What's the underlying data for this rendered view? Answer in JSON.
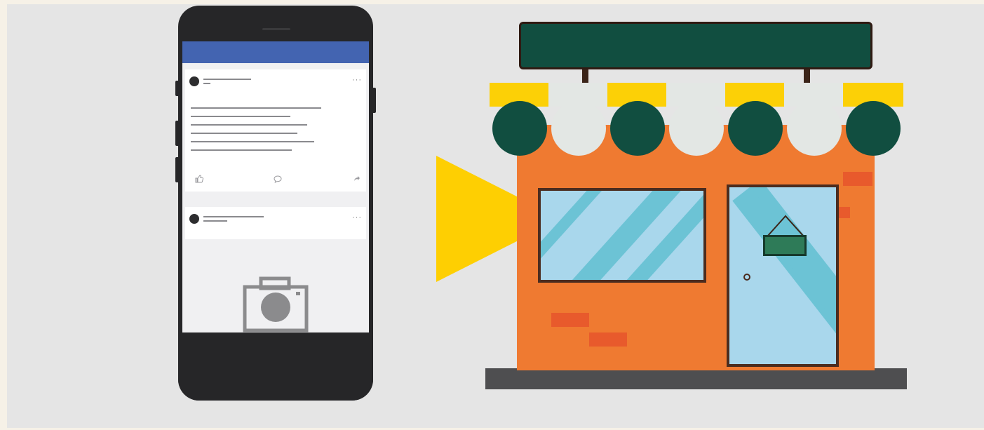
{
  "scene": {
    "phone": {
      "feed_posts": 2,
      "post_actions_icons": [
        "like-icon",
        "comment-icon",
        "share-icon"
      ],
      "photo_placeholder_icon": "camera-icon"
    },
    "arrow_icon": "play-arrow-icon",
    "store": {
      "awning_colors": [
        "#fcd006",
        "#114e40",
        "#e3e7e4"
      ],
      "wall_color": "#ef7a31",
      "sign_color": "#114e40"
    }
  },
  "colors": {
    "background": "#e5e5e5",
    "phone_header": "#4364b1",
    "arrow": "#fecf02"
  }
}
